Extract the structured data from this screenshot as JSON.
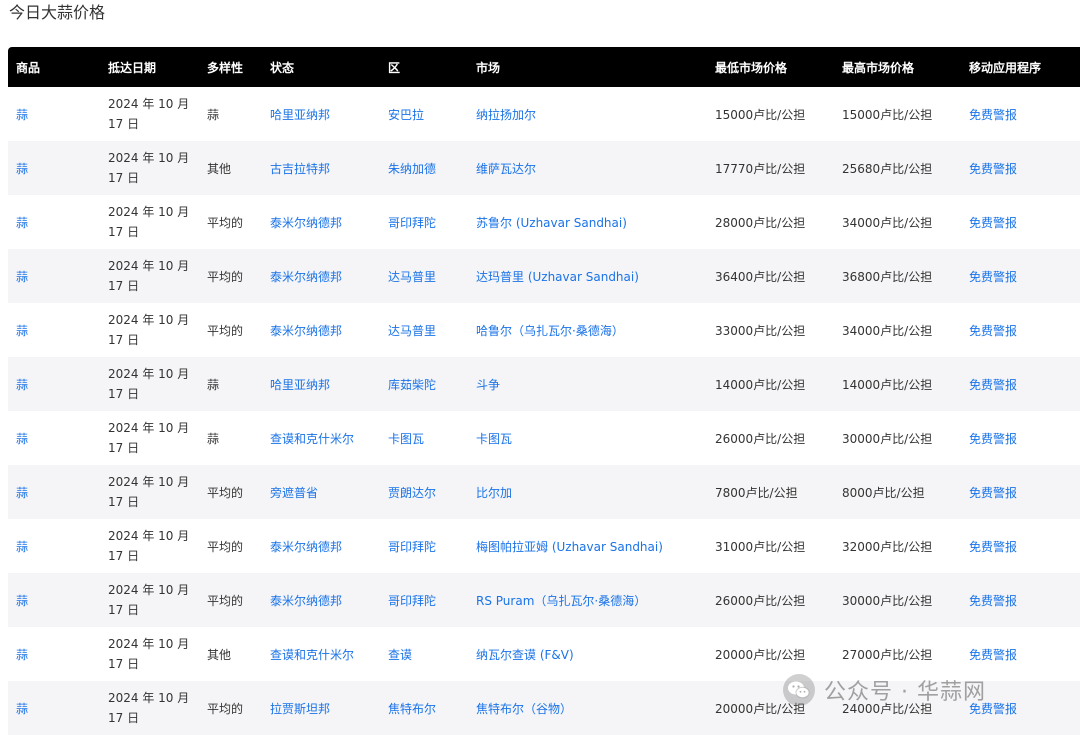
{
  "title": "今日大蒜价格",
  "table": {
    "headers": [
      "商品",
      "抵达日期",
      "多样性",
      "状态",
      "区",
      "市场",
      "最低市场价格",
      "最高市场价格",
      "移动应用程序"
    ],
    "rows": [
      {
        "commodity": "蒜",
        "date_line1": "2024 年 10 月",
        "date_line2": "17 日",
        "variety": "蒜",
        "state": "哈里亚纳邦",
        "district": "安巴拉",
        "market": "纳拉扬加尔",
        "min_price": "15000卢比/公担",
        "max_price": "15000卢比/公担",
        "app": "免费警报"
      },
      {
        "commodity": "蒜",
        "date_line1": "2024 年 10 月",
        "date_line2": "17 日",
        "variety": "其他",
        "state": "古吉拉特邦",
        "district": "朱纳加德",
        "market": "维萨瓦达尔",
        "min_price": "17770卢比/公担",
        "max_price": "25680卢比/公担",
        "app": "免费警报"
      },
      {
        "commodity": "蒜",
        "date_line1": "2024 年 10 月",
        "date_line2": "17 日",
        "variety": "平均的",
        "state": "泰米尔纳德邦",
        "district": "哥印拜陀",
        "market": "苏鲁尔 (Uzhavar Sandhai)",
        "min_price": "28000卢比/公担",
        "max_price": "34000卢比/公担",
        "app": "免费警报"
      },
      {
        "commodity": "蒜",
        "date_line1": "2024 年 10 月",
        "date_line2": "17 日",
        "variety": "平均的",
        "state": "泰米尔纳德邦",
        "district": "达马普里",
        "market": "达玛普里 (Uzhavar Sandhai)",
        "min_price": "36400卢比/公担",
        "max_price": "36800卢比/公担",
        "app": "免费警报"
      },
      {
        "commodity": "蒜",
        "date_line1": "2024 年 10 月",
        "date_line2": "17 日",
        "variety": "平均的",
        "state": "泰米尔纳德邦",
        "district": "达马普里",
        "market": "哈鲁尔（乌扎瓦尔·桑德海）",
        "min_price": "33000卢比/公担",
        "max_price": "34000卢比/公担",
        "app": "免费警报"
      },
      {
        "commodity": "蒜",
        "date_line1": "2024 年 10 月",
        "date_line2": "17 日",
        "variety": "蒜",
        "state": "哈里亚纳邦",
        "district": "库茹柴陀",
        "market": "斗争",
        "min_price": "14000卢比/公担",
        "max_price": "14000卢比/公担",
        "app": "免费警报"
      },
      {
        "commodity": "蒜",
        "date_line1": "2024 年 10 月",
        "date_line2": "17 日",
        "variety": "蒜",
        "state": "查谟和克什米尔",
        "district": "卡图瓦",
        "market": "卡图瓦",
        "min_price": "26000卢比/公担",
        "max_price": "30000卢比/公担",
        "app": "免费警报"
      },
      {
        "commodity": "蒜",
        "date_line1": "2024 年 10 月",
        "date_line2": "17 日",
        "variety": "平均的",
        "state": "旁遮普省",
        "district": "贾朗达尔",
        "market": "比尔加",
        "min_price": "7800卢比/公担",
        "max_price": "8000卢比/公担",
        "app": "免费警报"
      },
      {
        "commodity": "蒜",
        "date_line1": "2024 年 10 月",
        "date_line2": "17 日",
        "variety": "平均的",
        "state": "泰米尔纳德邦",
        "district": "哥印拜陀",
        "market": "梅图帕拉亚姆 (Uzhavar Sandhai)",
        "min_price": "31000卢比/公担",
        "max_price": "32000卢比/公担",
        "app": "免费警报"
      },
      {
        "commodity": "蒜",
        "date_line1": "2024 年 10 月",
        "date_line2": "17 日",
        "variety": "平均的",
        "state": "泰米尔纳德邦",
        "district": "哥印拜陀",
        "market": "RS Puram（乌扎瓦尔·桑德海）",
        "min_price": "26000卢比/公担",
        "max_price": "30000卢比/公担",
        "app": "免费警报"
      },
      {
        "commodity": "蒜",
        "date_line1": "2024 年 10 月",
        "date_line2": "17 日",
        "variety": "其他",
        "state": "查谟和克什米尔",
        "district": "查谟",
        "market": "纳瓦尔查谟 (F&V)",
        "min_price": "20000卢比/公担",
        "max_price": "27000卢比/公担",
        "app": "免费警报"
      },
      {
        "commodity": "蒜",
        "date_line1": "2024 年 10 月",
        "date_line2": "17 日",
        "variety": "平均的",
        "state": "拉贾斯坦邦",
        "district": "焦特布尔",
        "market": "焦特布尔（谷物）",
        "min_price": "20000卢比/公担",
        "max_price": "24000卢比/公担",
        "app": "免费警报"
      }
    ]
  },
  "watermark": {
    "text": "公众号 · 华蒜网",
    "icon": "wechat-icon"
  }
}
